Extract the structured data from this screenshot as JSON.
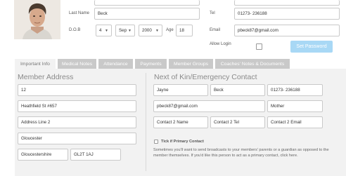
{
  "profile": {
    "last_name_label": "Last Name",
    "last_name_value": "Beck",
    "dob_label": "D.O.B",
    "dob_day": "4",
    "dob_month": "Sep",
    "dob_year": "2000",
    "age_label": "Age",
    "age_value": "18",
    "allow_login_label": "Allow Login",
    "tel_label": "Tel",
    "tel_value": "01273- 236188",
    "email_label": "Email",
    "email_value": "pbeck87@gmail.com",
    "set_password_label": "Set Password"
  },
  "tabs": [
    {
      "label": "Important Info"
    },
    {
      "label": "Medical Notes"
    },
    {
      "label": "Attendance"
    },
    {
      "label": "Payments"
    },
    {
      "label": "Member Groups"
    },
    {
      "label": "Coaches' Notes & Documents"
    }
  ],
  "address": {
    "heading": "Member Address",
    "line1": "12",
    "line2": "Heathfield St #657",
    "line3_placeholder": "Address Line 2",
    "city": "Gloucester",
    "county": "Gloucestershire",
    "postcode": "GL2T 1AJ"
  },
  "kin": {
    "heading": "Next of Kin/Emergency Contact",
    "first_name": "Jayne",
    "last_name": "Beck",
    "tel": "01273- 236188",
    "email": "pbeck87@gmail.com",
    "relation": "Mother",
    "c2_name_placeholder": "Contact 2 Name",
    "c2_tel_placeholder": "Contact 2 Tel",
    "c2_email_placeholder": "Contact 2 Email",
    "primary_label": "Tick if Primary Contact",
    "help_line1": "Sometimes you'll want to send broadcasts to your members' parents or a guardian as opposed to the",
    "help_line2": "member themselves. If you'd like this person to act as a primary contact, click here."
  },
  "colors": {
    "accent": "#a8d8f5",
    "tab_inactive": "#c9c9c9",
    "panel": "#f2f2f2"
  }
}
